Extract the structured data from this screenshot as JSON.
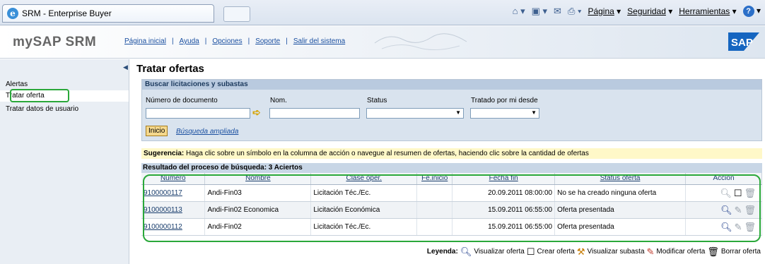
{
  "browser": {
    "tab_title": "SRM - Enterprise Buyer",
    "menu_pagina": "Página",
    "menu_seguridad": "Seguridad",
    "menu_herramientas": "Herramientas"
  },
  "header": {
    "brand": "mySAP SRM",
    "links": [
      "Página inicial",
      "Ayuda",
      "Opciones",
      "Soporte",
      "Salir del sistema"
    ],
    "logo_text": "SAP"
  },
  "sidebar": {
    "items": [
      {
        "label": "Alertas"
      },
      {
        "label": "Tratar oferta"
      },
      {
        "label": "Tratar datos de usuario"
      }
    ]
  },
  "page": {
    "title": "Tratar ofertas"
  },
  "search": {
    "header": "Buscar licitaciones y subastas",
    "label_doc": "Número de documento",
    "label_nom": "Nom.",
    "label_status": "Status",
    "label_tratado": "Tratado por mi desde",
    "doc_value": "",
    "nom_value": "",
    "status_value": "",
    "tratado_value": "",
    "start_button": "Inicio",
    "advanced_link": "Búsqueda ampliada"
  },
  "hint": {
    "prefix": "Sugerencia:",
    "text": " Haga clic sobre un símbolo en la columna de acción o navegue al resumen de ofertas, haciendo clic sobre la cantidad de ofertas"
  },
  "results": {
    "header": "Resultado del proceso de búsqueda:  3 Aciertos",
    "columns": [
      "Número",
      "Nombre",
      "Clase oper.",
      "Fe.inicio",
      "Fecha fin",
      "Status oferta",
      "Acción"
    ],
    "rows": [
      {
        "numero": "9100000117",
        "nombre": "Andi-Fin03",
        "clase": "Licitación Téc./Ec.",
        "inicio": "",
        "fin": "20.09.2011 08:00:00",
        "status": "No se ha creado ninguna oferta"
      },
      {
        "numero": "9100000113",
        "nombre": "Andi-Fin02 Economica",
        "clase": "Licitación Económica",
        "inicio": "",
        "fin": "15.09.2011 06:55:00",
        "status": "Oferta presentada"
      },
      {
        "numero": "9100000112",
        "nombre": "Andi-Fin02",
        "clase": "Licitación Téc./Ec.",
        "inicio": "",
        "fin": "15.09.2011 06:55:00",
        "status": "Oferta presentada"
      }
    ]
  },
  "legend": {
    "title": "Leyenda:",
    "items": [
      "Visualizar oferta",
      "Crear oferta",
      "Visualizar subasta",
      "Modificar oferta",
      "Borrar oferta"
    ]
  },
  "colors": {
    "highlight": "#2aa83a",
    "link": "#1a4fa0"
  }
}
